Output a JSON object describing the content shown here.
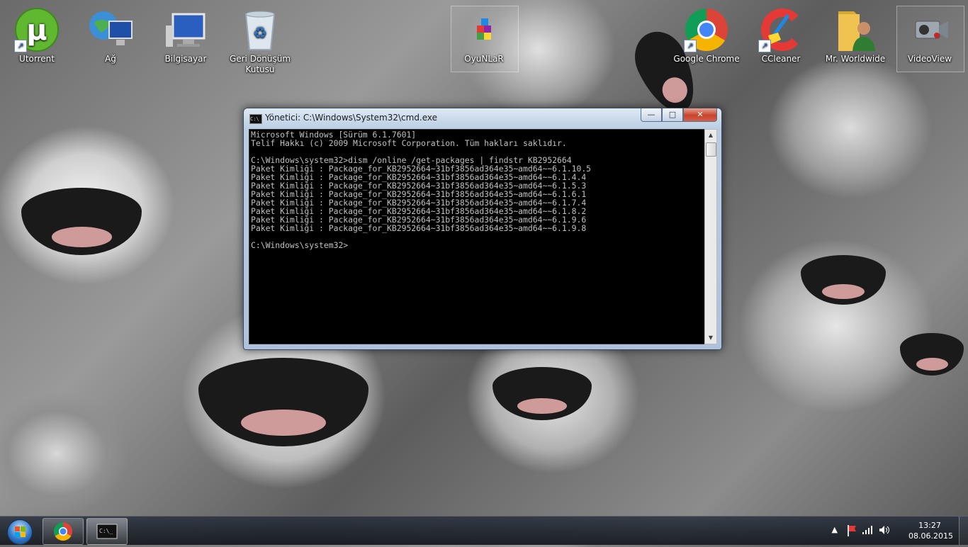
{
  "desktop": {
    "icons": [
      {
        "label": "Utorrent",
        "icon": "utorrent-icon",
        "shortcut": true
      },
      {
        "label": "Ağ",
        "icon": "network-icon",
        "shortcut": false
      },
      {
        "label": "Bilgisayar",
        "icon": "computer-icon",
        "shortcut": false
      },
      {
        "label": "Geri Dönüşüm Kutusu",
        "icon": "recycle-bin-icon",
        "shortcut": false
      },
      {
        "label": "OyuNLaR",
        "icon": "games-icon",
        "shortcut": false
      },
      {
        "label": "Google Chrome",
        "icon": "chrome-icon",
        "shortcut": true
      },
      {
        "label": "CCleaner",
        "icon": "ccleaner-icon",
        "shortcut": true
      },
      {
        "label": "Mr. Worldwide",
        "icon": "user-folder-icon",
        "shortcut": false
      },
      {
        "label": "VideoView",
        "icon": "video-camera-icon",
        "shortcut": false
      }
    ]
  },
  "cmd_window": {
    "title": "Yönetici: C:\\Windows\\System32\\cmd.exe",
    "buttons": {
      "minimize": "—",
      "maximize": "□",
      "close": "✕"
    },
    "lines": [
      "Microsoft Windows [Sürüm 6.1.7601]",
      "Telif Hakkı (c) 2009 Microsoft Corporation. Tüm hakları saklıdır.",
      "",
      "C:\\Windows\\system32>dism /online /get-packages | findstr KB2952664",
      "Paket Kimliği : Package_for_KB2952664~31bf3856ad364e35~amd64~~6.1.10.5",
      "Paket Kimliği : Package_for_KB2952664~31bf3856ad364e35~amd64~~6.1.4.4",
      "Paket Kimliği : Package_for_KB2952664~31bf3856ad364e35~amd64~~6.1.5.3",
      "Paket Kimliği : Package_for_KB2952664~31bf3856ad364e35~amd64~~6.1.6.1",
      "Paket Kimliği : Package_for_KB2952664~31bf3856ad364e35~amd64~~6.1.7.4",
      "Paket Kimliği : Package_for_KB2952664~31bf3856ad364e35~amd64~~6.1.8.2",
      "Paket Kimliği : Package_for_KB2952664~31bf3856ad364e35~amd64~~6.1.9.6",
      "Paket Kimliği : Package_for_KB2952664~31bf3856ad364e35~amd64~~6.1.9.8",
      "",
      "C:\\Windows\\system32>"
    ]
  },
  "taskbar": {
    "start_icon": "windows-start-icon",
    "apps": [
      {
        "icon": "chrome-icon"
      },
      {
        "icon": "cmd-icon"
      }
    ],
    "tray_icons": [
      "show-hidden-icons-icon",
      "action-center-flag-icon",
      "network-signal-icon",
      "volume-icon"
    ],
    "time": "13:27",
    "date": "08.06.2015"
  },
  "colors": {
    "console_bg": "#000000",
    "console_text": "#c0c0c0",
    "close_button": "#c6432b",
    "taskbar": "#1e252f"
  }
}
